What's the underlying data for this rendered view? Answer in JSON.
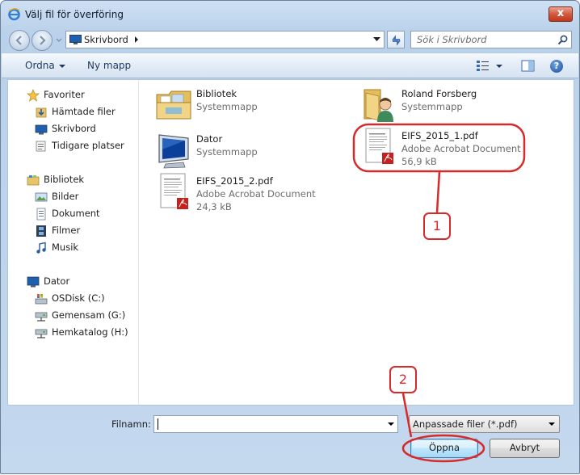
{
  "window": {
    "title": "Välj fil för överföring",
    "close_label": "x"
  },
  "address": {
    "crumb": "Skrivbord",
    "search_placeholder": "Sök i Skrivbord"
  },
  "toolbar": {
    "organize_label": "Ordna",
    "new_folder_label": "Ny mapp",
    "help_label": "?"
  },
  "sidebar": {
    "favorites": {
      "label": "Favoriter",
      "items": [
        "Hämtade filer",
        "Skrivbord",
        "Tidigare platser"
      ]
    },
    "libraries": {
      "label": "Bibliotek",
      "items": [
        "Bilder",
        "Dokument",
        "Filmer",
        "Musik"
      ]
    },
    "computer": {
      "label": "Dator",
      "items": [
        "OSDisk (C:)",
        "Gemensam (G:)",
        "Hemkatalog (H:)"
      ]
    }
  },
  "files": [
    {
      "name": "Bibliotek",
      "type": "Systemmapp",
      "size": "",
      "icon": "library-folder-icon"
    },
    {
      "name": "Roland Forsberg",
      "type": "Systemmapp",
      "size": "",
      "icon": "user-folder-icon"
    },
    {
      "name": "Dator",
      "type": "Systemmapp",
      "size": "",
      "icon": "computer-icon"
    },
    {
      "name": "EIFS_2015_1.pdf",
      "type": "Adobe Acrobat Document",
      "size": "56,9 kB",
      "icon": "pdf-file-icon"
    },
    {
      "name": "EIFS_2015_2.pdf",
      "type": "Adobe Acrobat Document",
      "size": "24,3 kB",
      "icon": "pdf-file-icon"
    }
  ],
  "bottom": {
    "filename_label": "Filnamn:",
    "filename_value": "",
    "filetype_selected": "Anpassade filer (*.pdf)",
    "open_label": "Öppna",
    "cancel_label": "Avbryt"
  },
  "annotations": {
    "color": "#d62b2b",
    "labels": [
      "1",
      "2"
    ]
  }
}
